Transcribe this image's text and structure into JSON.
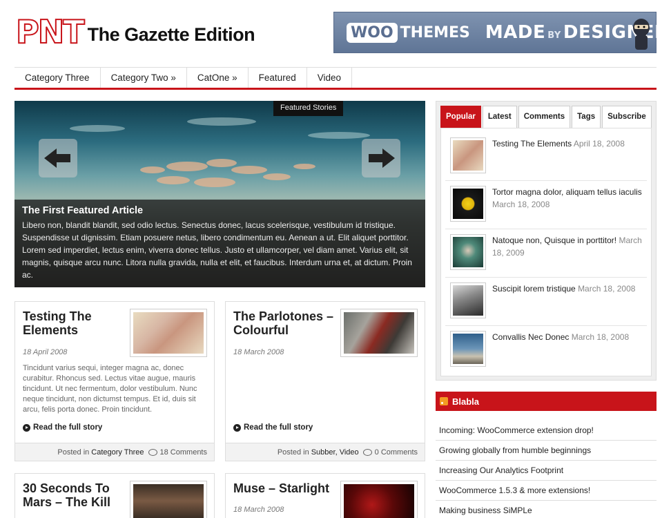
{
  "header": {
    "logo_mark": "PNT",
    "site_title": "The Gazette Edition",
    "banner": {
      "woo": "WOO",
      "themes": "THEMES",
      "made": "MADE",
      "by": "BY",
      "designers": "DESIGNERS"
    }
  },
  "nav": {
    "items": [
      {
        "label": "Category Three"
      },
      {
        "label": "Category Two »"
      },
      {
        "label": "CatOne »"
      },
      {
        "label": "Featured"
      },
      {
        "label": "Video"
      }
    ]
  },
  "slider": {
    "label": "Featured Stories",
    "title": "The First Featured Article",
    "text": "Libero non, blandit blandit, sed odio lectus. Senectus donec, lacus scelerisque, vestibulum id tristique. Suspendisse ut dignissim. Etiam posuere netus, libero condimentum eu. Aenean a ut. Elit aliquet porttitor. Lorem sed imperdiet, lectus enim, viverra donec tellus. Justo et ullamcorper, vel diam amet. Varius elit, sit magnis, quisque arcu nunc. Litora nulla gravida, nulla et elit, et faucibus. Interdum urna et, at dictum. Proin ac."
  },
  "posts": [
    {
      "title": "Testing The Elements",
      "date": "18 April 2008",
      "excerpt": "Tincidunt varius sequi, integer magna ac, donec curabitur. Rhoncus sed. Lectus vitae augue, mauris tincidunt. Ut nec fermentum, dolor vestibulum. Nunc neque tincidunt, non dictumst tempus. Et id, duis sit arcu, felis porta donec. Proin tincidunt.",
      "more": "Read the full story",
      "posted_in": "Posted in",
      "category": "Category Three",
      "comments": "18 Comments"
    },
    {
      "title": "The Parlotones – Colourful",
      "date": "18 March 2008",
      "excerpt": "",
      "more": "Read the full story",
      "posted_in": "Posted in",
      "category": "Subber, Video",
      "comments": "0 Comments"
    },
    {
      "title": "30 Seconds To Mars – The Kill",
      "date": ""
    },
    {
      "title": "Muse – Starlight",
      "date": "18 March 2008"
    }
  ],
  "sidebar": {
    "tabs": [
      {
        "label": "Popular",
        "active": true
      },
      {
        "label": "Latest"
      },
      {
        "label": "Comments"
      },
      {
        "label": "Tags"
      },
      {
        "label": "Subscribe"
      }
    ],
    "popular": [
      {
        "title": "Testing The Elements",
        "date": "April 18, 2008"
      },
      {
        "title": "Tortor magna dolor, aliquam tellus iaculis",
        "date": "March 18, 2008"
      },
      {
        "title": "Natoque non, Quisque in porttitor!",
        "date": "March 18, 2009"
      },
      {
        "title": "Suscipit lorem tristique",
        "date": "March 18, 2008"
      },
      {
        "title": "Convallis Nec Donec",
        "date": "March 18, 2008"
      }
    ],
    "feed_title": "Blabla",
    "feed": [
      {
        "label": "Incoming: WooCommerce extension drop!"
      },
      {
        "label": "Growing globally from humble beginnings"
      },
      {
        "label": "Increasing Our Analytics Footprint"
      },
      {
        "label": "WooCommerce 1.5.3 & more extensions!"
      },
      {
        "label": "Making business SiMPLe"
      }
    ]
  },
  "colors": {
    "accent": "#c8141a",
    "banner": "#6b80a0"
  }
}
